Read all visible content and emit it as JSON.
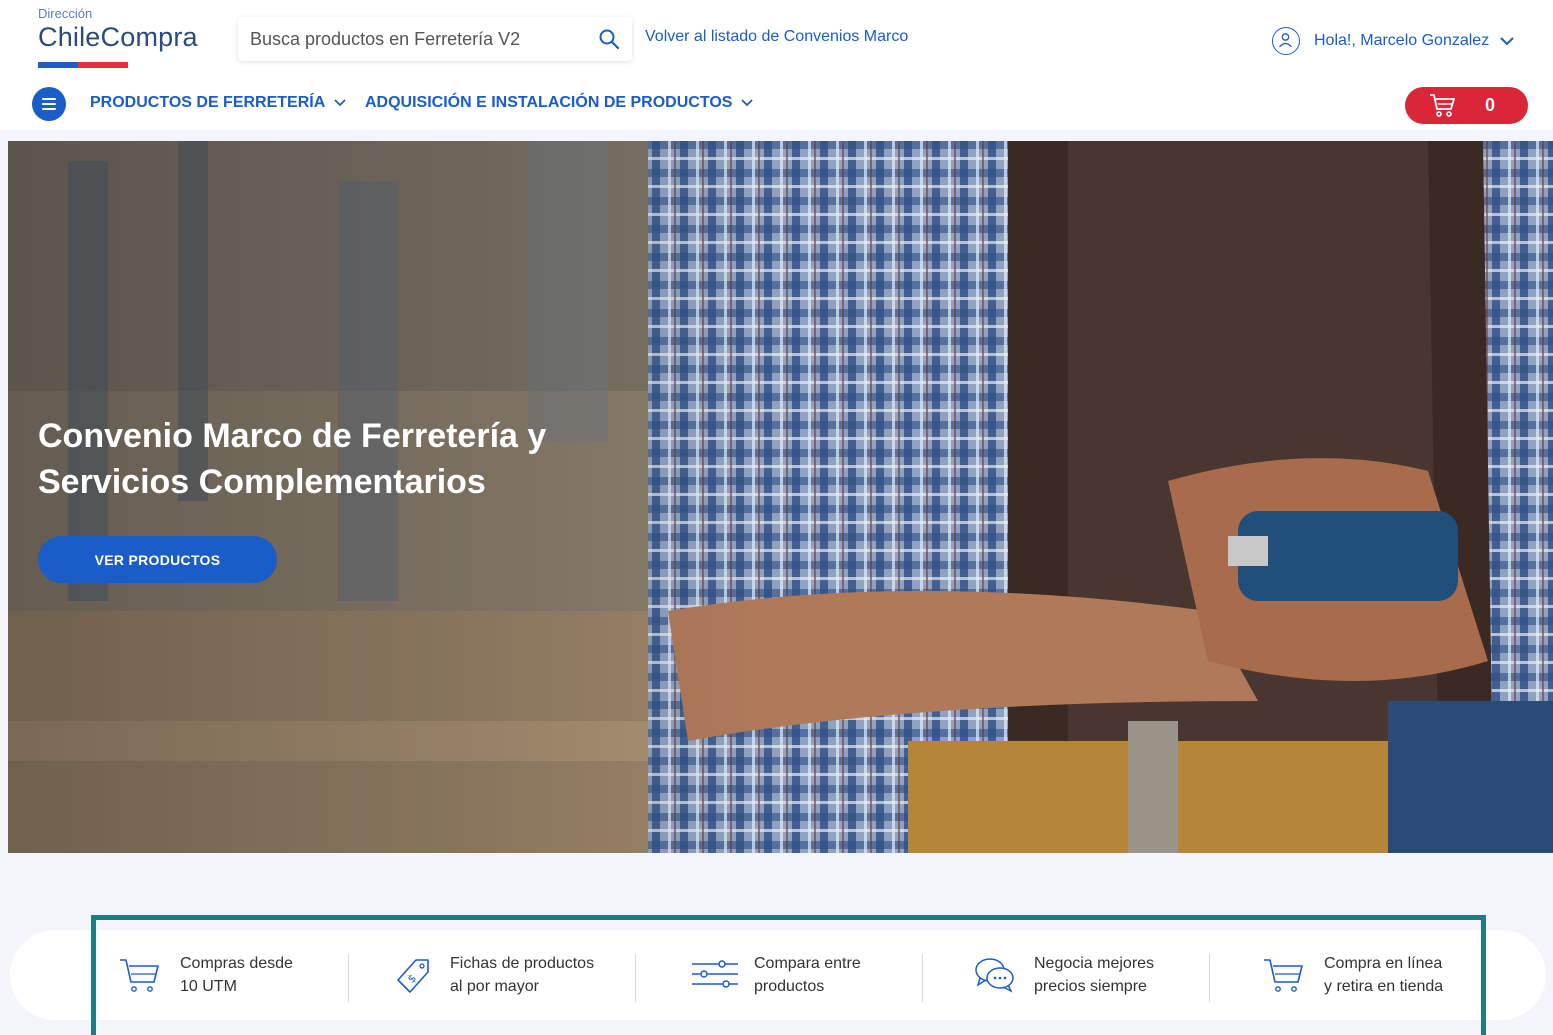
{
  "brand": {
    "line1": "Dirección",
    "line2": "ChileCompra",
    "colors": {
      "blue": "#1f5cc6",
      "red": "#e23240"
    }
  },
  "search": {
    "placeholder": "Busca productos en Ferretería V2",
    "value": "",
    "icon": "search-icon"
  },
  "header": {
    "back_link": "Volver al listado de Convenios Marco",
    "user_greeting": "Hola!, Marcelo Gonzalez",
    "user_icon": "user-icon"
  },
  "nav": {
    "menu_icon": "hamburger-menu-icon",
    "items": [
      {
        "label": "PRODUCTOS DE FERRETERÍA"
      },
      {
        "label": "ADQUISICIÓN E INSTALACIÓN DE PRODUCTOS"
      }
    ]
  },
  "cart": {
    "count": "0",
    "icon": "cart-icon",
    "color": "#d92638"
  },
  "hero": {
    "title_line1": "Convenio Marco de Ferretería y",
    "title_line2": "Servicios Complementarios",
    "button_label": "VER PRODUCTOS"
  },
  "features": [
    {
      "icon": "cart-icon",
      "line1": "Compras desde",
      "line2": "10 UTM"
    },
    {
      "icon": "price-tag-icon",
      "line1": "Fichas de productos",
      "line2": "al por mayor"
    },
    {
      "icon": "sliders-icon",
      "line1": "Compara entre",
      "line2": "productos"
    },
    {
      "icon": "chat-bubbles-icon",
      "line1": "Negocia mejores",
      "line2": "precios siempre"
    },
    {
      "icon": "cart-icon",
      "line1": "Compra en línea",
      "line2": "y retira en tienda"
    }
  ],
  "accent_color": "#1a5cc8"
}
